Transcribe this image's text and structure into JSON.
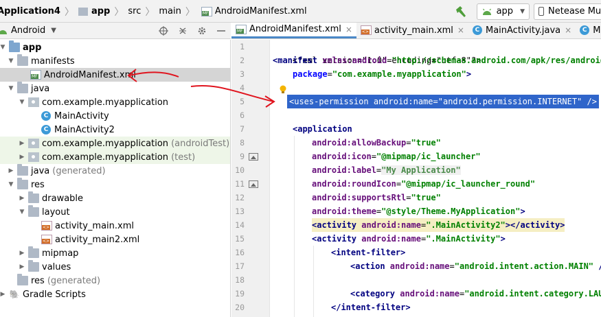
{
  "breadcrumbs": [
    "Application4",
    "app",
    "src",
    "main",
    "AndroidManifest.xml"
  ],
  "toolbar": {
    "run_config": "app",
    "device": "Netease Mul"
  },
  "project_panel": {
    "title": "Android",
    "items": [
      {
        "label": "app",
        "suffix": ""
      },
      {
        "label": "manifests",
        "suffix": ""
      },
      {
        "label": "AndroidManifest.xml",
        "suffix": ""
      },
      {
        "label": "java",
        "suffix": ""
      },
      {
        "label": "com.example.myapplication",
        "suffix": ""
      },
      {
        "label": "MainActivity",
        "suffix": ""
      },
      {
        "label": "MainActivity2",
        "suffix": ""
      },
      {
        "label": "com.example.myapplication",
        "suffix": "(androidTest)"
      },
      {
        "label": "com.example.myapplication",
        "suffix": "(test)"
      },
      {
        "label": "java",
        "suffix": "(generated)"
      },
      {
        "label": "res",
        "suffix": ""
      },
      {
        "label": "drawable",
        "suffix": ""
      },
      {
        "label": "layout",
        "suffix": ""
      },
      {
        "label": "activity_main.xml",
        "suffix": ""
      },
      {
        "label": "activity_main2.xml",
        "suffix": ""
      },
      {
        "label": "mipmap",
        "suffix": ""
      },
      {
        "label": "values",
        "suffix": ""
      },
      {
        "label": "res",
        "suffix": "(generated)"
      },
      {
        "label": "Gradle Scripts",
        "suffix": ""
      }
    ]
  },
  "tabs": [
    {
      "label": "AndroidManifest.xml"
    },
    {
      "label": "activity_main.xml"
    },
    {
      "label": "MainActivity.java"
    },
    {
      "label": "MainActivity"
    }
  ],
  "editor": {
    "line_numbers": [
      "1",
      "2",
      "3",
      "4",
      "5",
      "6",
      "7",
      "8",
      "9",
      "10",
      "11",
      "12",
      "13",
      "14",
      "15",
      "16",
      "17",
      "18",
      "19",
      "20"
    ],
    "lines": {
      "l1": "<?xml version=\"1.0\" encoding=\"utf-8\"?>",
      "l2a": "<manifest",
      "l2b": " xmlns:android",
      "l2c": "=",
      "l2d": "\"http://schemas.android.com/apk/res/android\"",
      "l3a": "package",
      "l3b": "=",
      "l3c": "\"com.example.myapplication\"",
      "l3d": ">",
      "l5a": "<uses-permission",
      "l5b": " android:name",
      "l5c": "=",
      "l5d": "\"android.permission.INTERNET\"",
      "l5e": " />",
      "l7": "<application",
      "l8a": "android:allowBackup",
      "l8b": "\"true\"",
      "l9a": "android:icon",
      "l9b": "\"@mipmap/ic_launcher\"",
      "l10a": "android:label",
      "l10b": "\"My Application\"",
      "l11a": "android:roundIcon",
      "l11b": "\"@mipmap/ic_launcher_round\"",
      "l12a": "android:supportsRtl",
      "l12b": "\"true\"",
      "l13a": "android:theme",
      "l13b": "\"@style/Theme.MyApplication\"",
      "l13c": ">",
      "l14a": "<activity",
      "l14b": " android:name",
      "l14c": "\".MainActivity2\"",
      "l14d": "></activity>",
      "l15a": "<activity",
      "l15b": " android:name",
      "l15c": "\".MainActivity\"",
      "l15d": ">",
      "l16": "<intent-filter>",
      "l17a": "<action",
      "l17b": " android:name",
      "l17c": "\"android.intent.action.MAIN\"",
      "l17d": " />",
      "l19a": "<category",
      "l19b": " android:name",
      "l19c": "\"android.intent.category.LAUN",
      "l20": "</intent-filter>",
      "eq": "="
    }
  },
  "colors": {
    "selection": "#2f65ca",
    "annotation": "#e0141e",
    "tab_underline": "#4a88c7"
  }
}
